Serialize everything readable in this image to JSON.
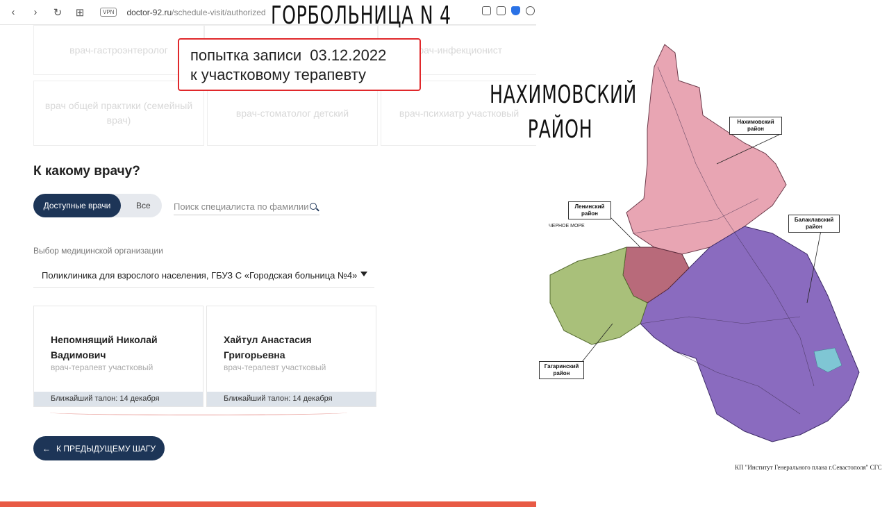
{
  "browser": {
    "vpn": "VPN",
    "domain": "doctor-92.ru",
    "path": "/schedule-visit/authorized"
  },
  "overlay": {
    "hospital_title": "ГОРБОЛЬНИЦА N 4",
    "note_line1": "попытка записи",
    "note_date": "03.12.2022",
    "note_line2": "к участковому терапевту",
    "district_line1": "НАХИМОВСКИЙ",
    "district_line2": "РАЙОН"
  },
  "specialties": [
    "врач-гастроэнтеролог",
    "врач-инфекционист",
    "врач общей практики (семейный врач)",
    "врач-стоматолог детский",
    "врач-психиатр участковый"
  ],
  "section_title": "К какому врачу?",
  "toggle": {
    "active": "Доступные врачи",
    "inactive": "Все"
  },
  "search": {
    "placeholder": "Поиск специалиста по фамилии"
  },
  "org": {
    "label": "Выбор медицинской организации",
    "selected": "Поликлиника для взрослого населения, ГБУЗ С «Городская больница №4»"
  },
  "doctors": [
    {
      "name": "Непомнящий Николай Вадимович",
      "role": "врач-терапевт участковый",
      "nearest": "Ближайший талон: 14 декабря"
    },
    {
      "name": "Хайтул Анастасия Григорьевна",
      "role": "врач-терапевт участковый",
      "nearest": "Ближайший талон: 14 декабря"
    }
  ],
  "back_button": "К ПРЕДЫДУЩЕМУ ШАГУ",
  "map": {
    "nakhimov": "Нахимовский район",
    "lenin": "Ленинский район",
    "balaklava": "Балаклавский район",
    "gagarin": "Гагаринский район",
    "sea": "ЧЕРНОЕ МОРЕ",
    "credit": "КП \"Институт Генерального плана г.Севастополя\" СГС"
  },
  "colors": {
    "primary": "#1d3557",
    "accent": "#e85a45",
    "note_border": "#e0282b",
    "map_pink": "#e8a5b3",
    "map_purple": "#8a6bbf",
    "map_green": "#a9c07a"
  }
}
